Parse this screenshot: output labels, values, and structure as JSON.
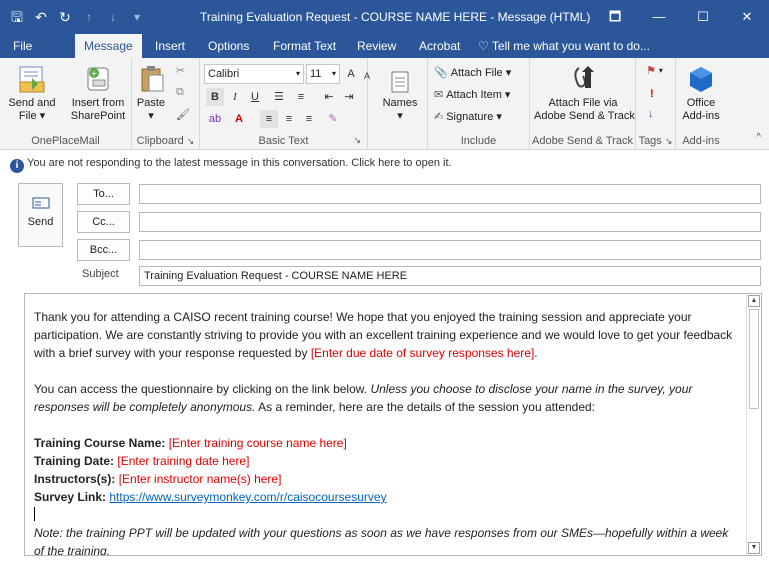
{
  "window": {
    "title": "Training Evaluation Request - COURSE NAME HERE - Message (HTML)",
    "controls": {
      "restore": "🗖",
      "minimize": "—",
      "maximize": "☐",
      "close": "✕"
    },
    "qat": {
      "save": "🖫",
      "undo": "↶",
      "redo": "↻",
      "up": "↑",
      "down": "↓",
      "customize": "▾"
    }
  },
  "tabs": [
    "File",
    "Message",
    "Insert",
    "Options",
    "Format Text",
    "Review",
    "Acrobat"
  ],
  "active_tab": "Message",
  "tell_me": "Tell me what you want to do...",
  "ribbon": {
    "oneplacemail": {
      "send_and_file": "Send and\nFile ▾",
      "insert_from_sharepoint": "Insert from\nSharePoint",
      "label": "OnePlaceMail"
    },
    "clipboard": {
      "paste": "Paste\n▾",
      "label": "Clipboard"
    },
    "basic_text": {
      "font": "Calibri",
      "size": "11",
      "bold": "B",
      "italic": "I",
      "underline": "U",
      "label": "Basic Text",
      "grow": "A",
      "shrink": "A"
    },
    "names": {
      "names": "Names",
      "arrow": "▾"
    },
    "include": {
      "attach_file": "Attach File ▾",
      "attach_item": "Attach Item ▾",
      "signature": "Signature ▾",
      "label": "Include"
    },
    "adobe": {
      "attach_via": "Attach File via\nAdobe Send & Track",
      "label": "Adobe Send & Track"
    },
    "tags": {
      "label": "Tags"
    },
    "addins": {
      "office_addins": "Office\nAdd-ins",
      "label": "Add-ins"
    }
  },
  "infobar": {
    "text": "You are not responding to the latest message in this conversation. Click here to open it.",
    "icon": "i"
  },
  "header": {
    "send": "Send",
    "to_label": "To...",
    "cc_label": "Cc...",
    "bcc_label": "Bcc...",
    "subject_label": "Subject",
    "to": "",
    "cc": "",
    "bcc": "",
    "subject": "Training Evaluation Request - COURSE NAME HERE"
  },
  "body": {
    "p1_start": "Thank you for attending a CAISO recent training course! We hope that you enjoyed the training session and appreciate your participation. We are constantly striving to provide you with an excellent training experience and we would love to get your feedback with a brief survey with your response requested by ",
    "p1_placeholder": "[Enter due date of survey responses here]",
    "p1_end": ".",
    "p2_start": "You can access the questionnaire by clicking on the link below. ",
    "p2_italic": "Unless you choose to disclose your name in the survey, your responses will be completely anonymous.",
    "p2_end": " As a reminder, here are the details of the session you attended:",
    "course_label": "Training Course Name:",
    "course_value": "[Enter training course name here]",
    "date_label": "Training Date:",
    "date_value": "[Enter training date here]",
    "instructors_label": "Instructors(s):",
    "instructors_value": "[Enter instructor name(s) here]",
    "survey_label": "Survey Link:",
    "survey_url": "https://www.surveymonkey.com/r/caisocoursesurvey",
    "note": "Note: the training PPT will be updated with your questions as soon as we have responses from our SMEs—hopefully within a week of the training.",
    "scroll_up": "▲",
    "scroll_down": "▼"
  },
  "colors": {
    "titlebar": "#2b579a",
    "placeholder_red": "#e00000",
    "link": "#0563c1"
  }
}
